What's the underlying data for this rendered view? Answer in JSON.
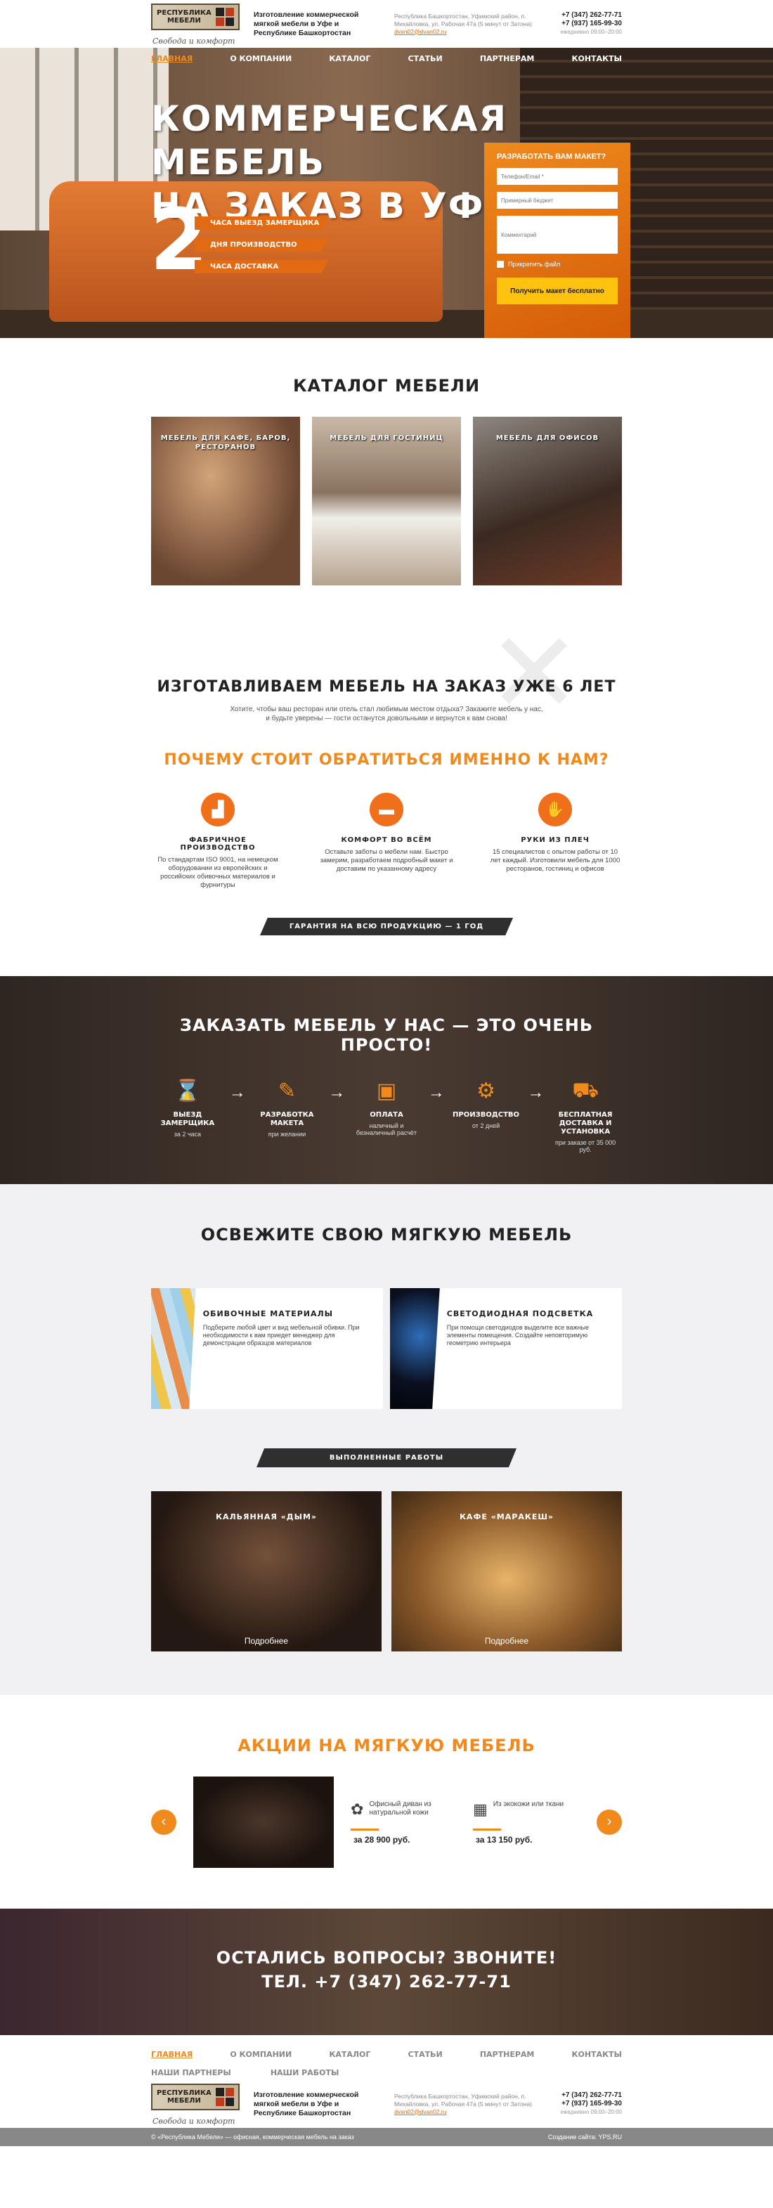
{
  "header": {
    "logo_line1": "РЕСПУБЛИКА",
    "logo_line2": "МЕБЕЛИ",
    "slogan": "Свобода и комфорт",
    "tagline": "Изготовление коммерческой мягкой мебели в Уфе и Республике Башкортостан",
    "address": "Республика Башкортостан, Уфимский район, п. Михайловка, ул. Рабочая 47а (5 минут от Затона)",
    "email": "dvan02@dvan02.ru",
    "phone1": "+7 (347) 262-77-71",
    "phone2": "+7 (937) 165-99-30",
    "hours": "ежедневно 09:00–20:00"
  },
  "nav": [
    "ГЛАВНАЯ",
    "О КОМПАНИИ",
    "КАТАЛОГ",
    "СТАТЬИ",
    "ПАРТНЕРАМ",
    "КОНТАКТЫ"
  ],
  "hero": {
    "title1": "КОММЕРЧЕСКАЯ МЕБЕЛЬ",
    "title2": "НА ЗАКАЗ В УФЕ",
    "big": "2",
    "r1": "ЧАСА ВЫЕЗД ЗАМЕРЩИКА",
    "r2": "ДНЯ ПРОИЗВОДСТВО",
    "r3": "ЧАСА ДОСТАВКА"
  },
  "form": {
    "title": "РАЗРАБОТАТЬ ВАМ МАКЕТ?",
    "ph_phone": "Телефон/Email *",
    "ph_budget": "Примерный бюджет",
    "ph_comment": "Комментарий",
    "attach": "Прикрепить файл",
    "button": "Получить макет бесплатно"
  },
  "catalog": {
    "title": "КАТАЛОГ МЕБЕЛИ",
    "c1": "МЕБЕЛЬ ДЛЯ КАФЕ, БАРОВ, РЕСТОРАНОВ",
    "c2": "МЕБЕЛЬ ДЛЯ ГОСТИНИЦ",
    "c3": "МЕБЕЛЬ ДЛЯ ОФИСОВ"
  },
  "make": {
    "title": "ИЗГОТАВЛИВАЕМ МЕБЕЛЬ НА ЗАКАЗ УЖЕ 6 ЛЕТ",
    "text1": "Хотите, чтобы ваш ресторан или отель стал любимым местом отдыха? Закажите мебель у нас,",
    "text2": "и будьте уверены — гости останутся довольными и вернутся к вам снова!"
  },
  "why": {
    "title": "ПОЧЕМУ СТОИТ ОБРАТИТЬСЯ ИМЕННО К НАМ?",
    "f1t": "ФАБРИЧНОЕ ПРОИЗВОДСТВО",
    "f1": "По стандартам ISO 9001, на немецком оборудовании из европейских и российских обивочных материалов и фурнитуры",
    "f2t": "КОМФОРТ ВО ВСЁМ",
    "f2": "Оставьте заботы о мебели нам. Быстро замерим, разработаем подробный макет и доставим по указанному адресу",
    "f3t": "РУКИ ИЗ ПЛЕЧ",
    "f3": "15 специалистов с опытом работы от 10 лет каждый. Изготовили мебель для 1000 ресторанов, гостиниц и офисов",
    "guarantee": "ГАРАНТИЯ НА ВСЮ ПРОДУКЦИЮ — 1 ГОД"
  },
  "steps": {
    "title": "ЗАКАЗАТЬ МЕБЕЛЬ У НАС — ЭТО ОЧЕНЬ ПРОСТО!",
    "s1t": "ВЫЕЗД ЗАМЕРЩИКА",
    "s1": "за 2 часа",
    "s2t": "РАЗРАБОТКА МАКЕТА",
    "s2": "при желании",
    "s3t": "ОПЛАТА",
    "s3": "наличный и безналичный расчёт",
    "s4t": "ПРОИЗВОДСТВО",
    "s4": "от 2 дней",
    "s5t": "БЕСПЛАТНАЯ ДОСТАВКА И УСТАНОВКА",
    "s5": "при заказе от 35 000 руб."
  },
  "refresh": {
    "title": "ОСВЕЖИТЕ СВОЮ МЯГКУЮ МЕБЕЛЬ",
    "b1t": "ОБИВОЧНЫЕ МАТЕРИАЛЫ",
    "b1": "Подберите любой цвет и вид мебельной обивки. При необходимости к вам приедет менеджер для демонстрации образцов материалов",
    "b2t": "СВЕТОДИОДНАЯ ПОДСВЕТКА",
    "b2": "При помощи светодиодов выделите все важные элементы помещения. Создайте неповторимую геометрию интерьера",
    "done": "ВЫПОЛНЕННЫЕ РАБОТЫ",
    "w1": "КАЛЬЯННАЯ «ДЫМ»",
    "w2": "КАФЕ «МАРАКЕШ»",
    "more": "Подробнее"
  },
  "promo": {
    "title": "АКЦИИ НА МЯГКУЮ МЕБЕЛЬ",
    "p1": "Офисный диван из натуральной кожи",
    "p1price": "за 28 900 руб.",
    "p2": "Из экокожи или ткани",
    "p2price": "за 13 150 руб.",
    "prev": "‹",
    "next": "›"
  },
  "cta": {
    "title": "ОСТАЛИСЬ ВОПРОСЫ? ЗВОНИТЕ!",
    "tel": "ТЕЛ. +7 (347) 262-77-71"
  },
  "footer": {
    "nav2_1": "НАШИ ПАРТНЕРЫ",
    "nav2_2": "НАШИ РАБОТЫ",
    "copy": "© «Республика Мебели» — офисная, коммерческая мебель на заказ",
    "made": "Создание сайта: YPS.RU"
  }
}
